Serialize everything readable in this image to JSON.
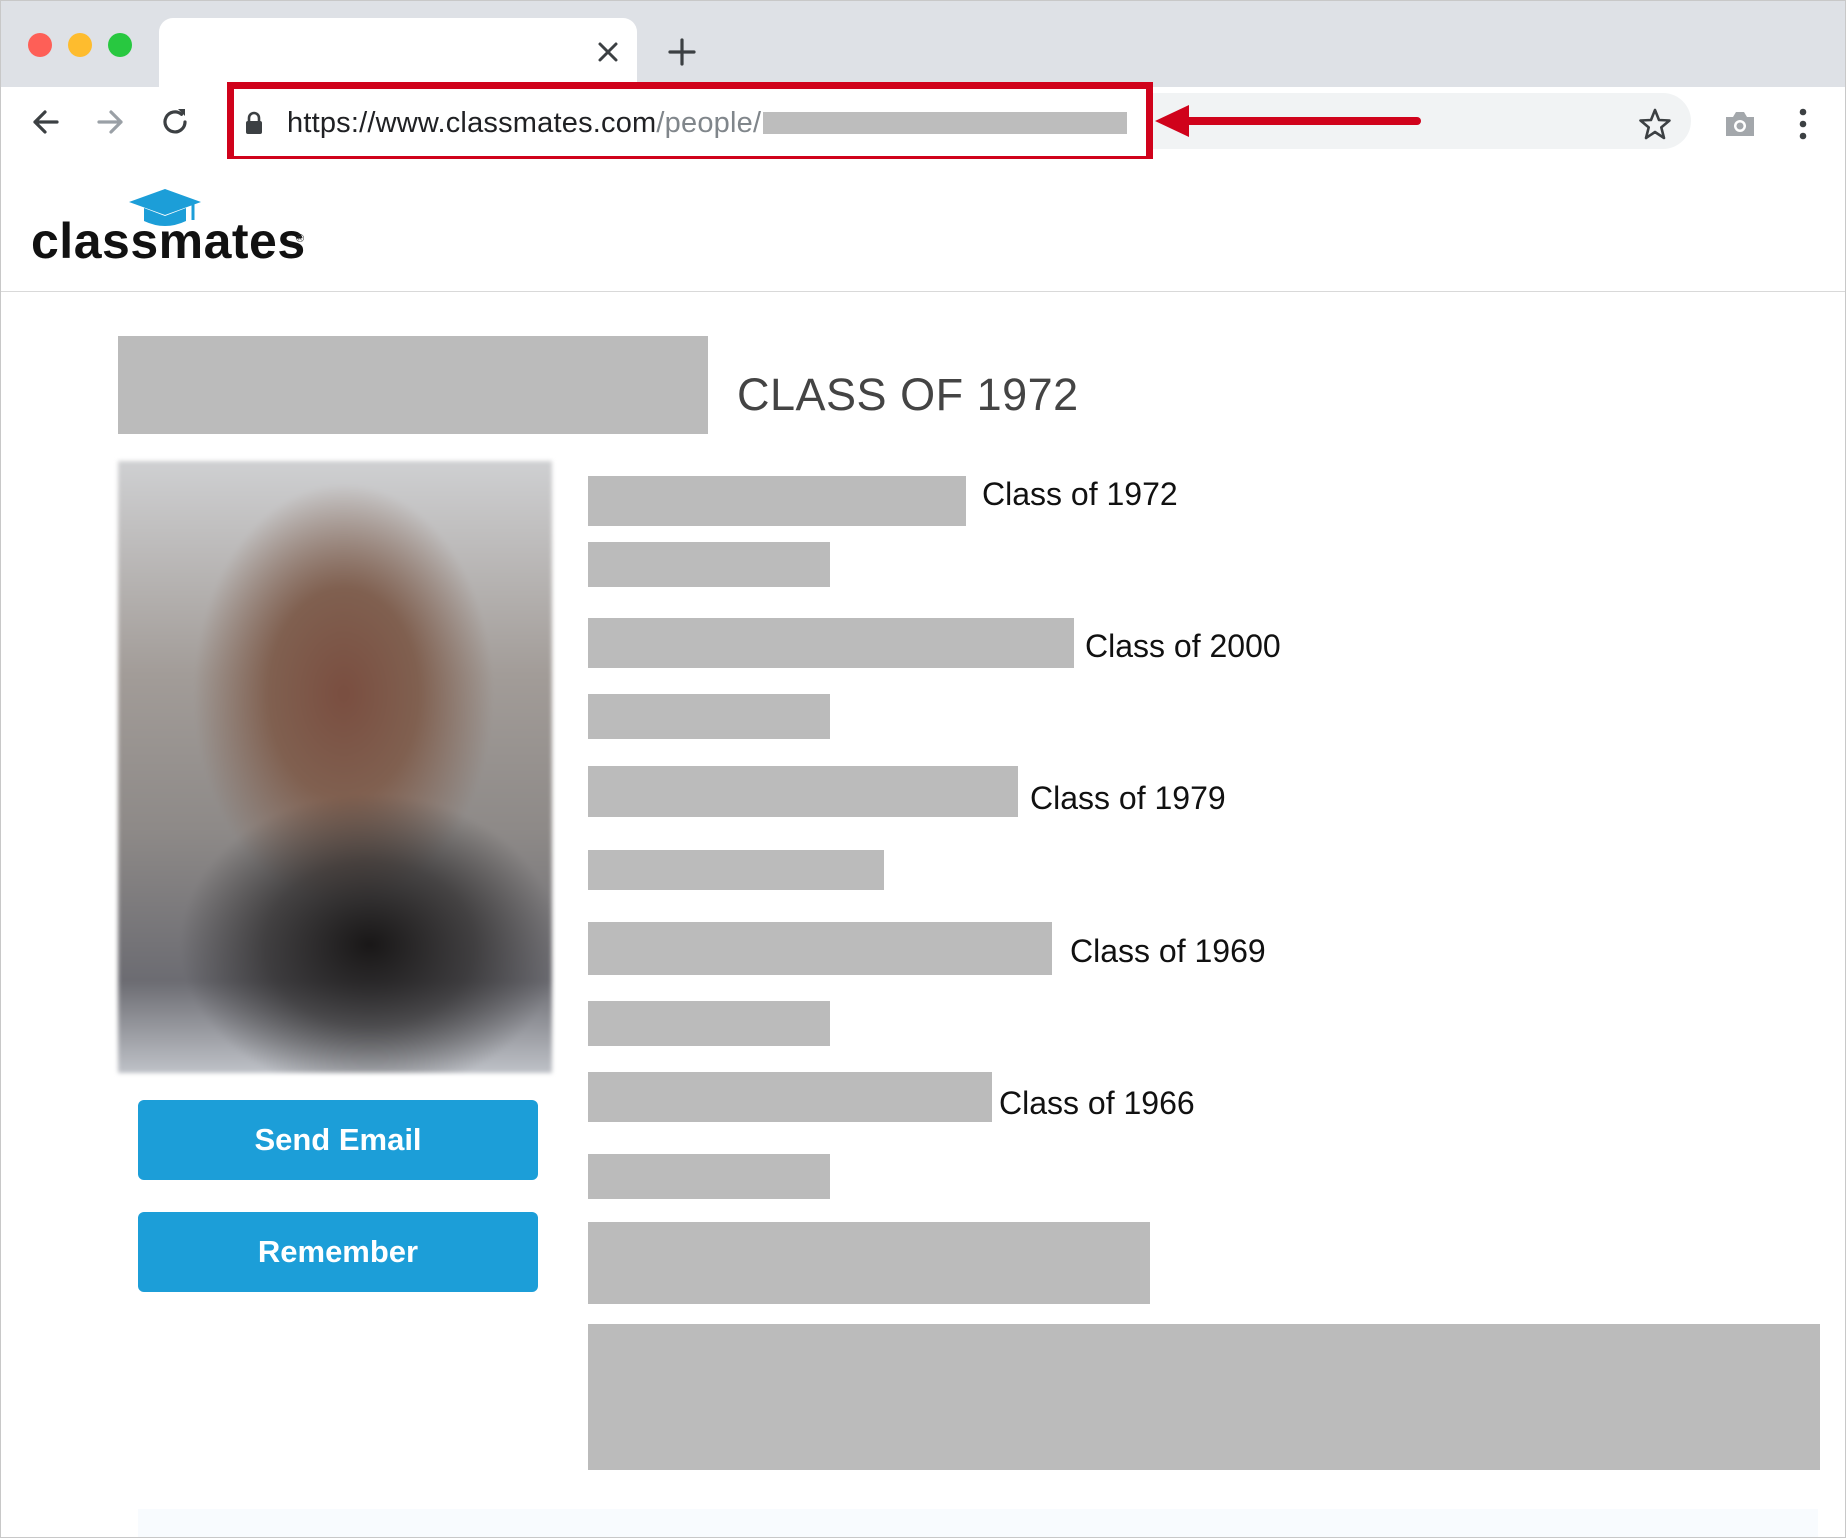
{
  "browser": {
    "url_host": "https://www.classmates.com",
    "url_path": "/people/",
    "icons": {
      "close_tab": "close-icon",
      "new_tab": "plus-icon",
      "back": "arrow-left-icon",
      "forward": "arrow-right-icon",
      "reload": "reload-icon",
      "secure": "lock-icon",
      "bookmark": "star-icon",
      "screenshot": "camera-icon",
      "menu": "kebab-menu-icon"
    },
    "traffic_lights": [
      "#fe5f57",
      "#febc2e",
      "#28c840"
    ],
    "annotation_color": "#d0021b"
  },
  "site": {
    "logo_text": "classmates",
    "logo_registered": "®",
    "brand_color": "#1c9ed8"
  },
  "profile": {
    "class_heading": "CLASS OF 1972",
    "buttons": {
      "send_email": "Send Email",
      "remember": "Remember"
    },
    "schools": [
      {
        "class_label": "Class of 1972"
      },
      {
        "class_label": "Class of 2000"
      },
      {
        "class_label": "Class of 1979"
      },
      {
        "class_label": "Class of 1969"
      },
      {
        "class_label": "Class of 1966"
      }
    ]
  }
}
